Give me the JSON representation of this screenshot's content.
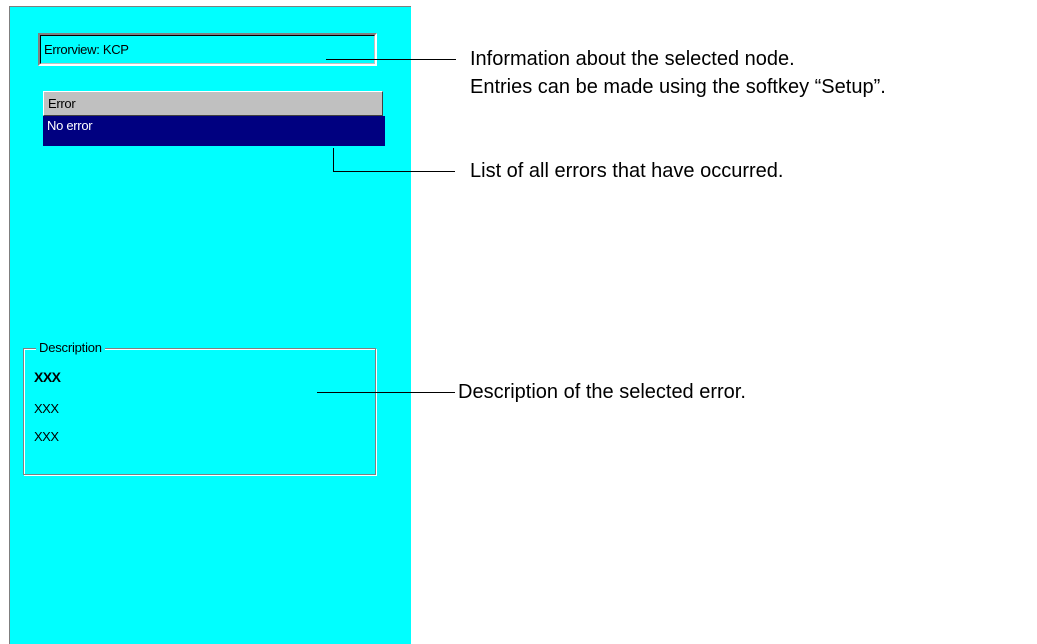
{
  "panel": {
    "node_info": "Errorview: KCP",
    "error_list": {
      "header": "Error",
      "rows": [
        "No error"
      ]
    },
    "description": {
      "legend": "Description",
      "lines": [
        "XXX",
        "XXX",
        "XXX"
      ]
    }
  },
  "callouts": {
    "node_info_line1": "Information about the selected node.",
    "node_info_line2": "Entries can be made using the softkey “Setup”.",
    "error_list": "List of all errors that have occurred.",
    "description": "Description of the selected error."
  },
  "colors": {
    "panel_background": "#00ffff",
    "selected_row": "#000080",
    "list_header": "#c0c0c0"
  }
}
